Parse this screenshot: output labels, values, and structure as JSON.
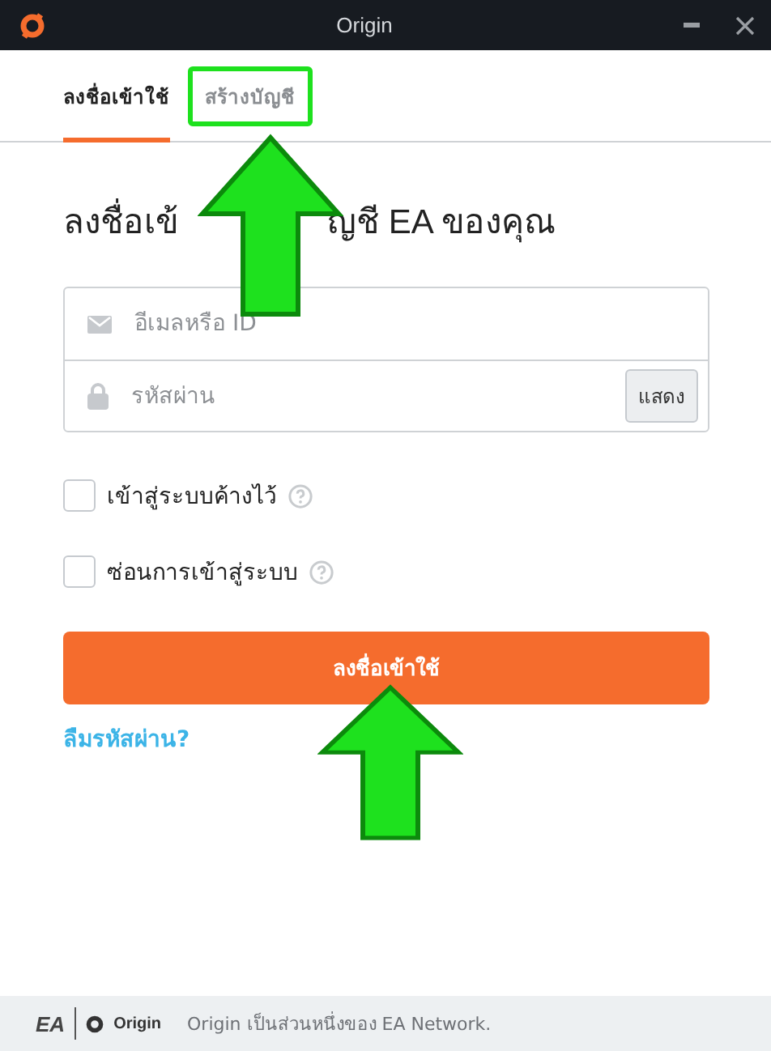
{
  "window": {
    "title": "Origin"
  },
  "tabs": [
    {
      "label": "ลงชื่อเข้าใช้",
      "selected": true,
      "highlighted": false
    },
    {
      "label": "สร้างบัญชี",
      "selected": false,
      "highlighted": true
    }
  ],
  "heading_parts": [
    "ลงชื่อเข้",
    "ญชี EA ของคุณ"
  ],
  "fields": [
    {
      "kind": "email",
      "placeholder": "อีเมลหรือ ID"
    },
    {
      "kind": "password",
      "placeholder": "รหัสผ่าน",
      "button": "แสดง"
    }
  ],
  "options": [
    {
      "label": "เข้าสู่ระบบค้างไว้",
      "checked": false
    },
    {
      "label": "ซ่อนการเข้าสู่ระบบ",
      "checked": false
    }
  ],
  "submit": {
    "label": "ลงชื่อเข้าใช้"
  },
  "forgot_link": "ลืมรหัสผ่าน?",
  "footer": {
    "ea_logo": "EA",
    "origin_logo": "Origin",
    "text": "Origin เป็นส่วนหนึ่งของ EA Network."
  }
}
